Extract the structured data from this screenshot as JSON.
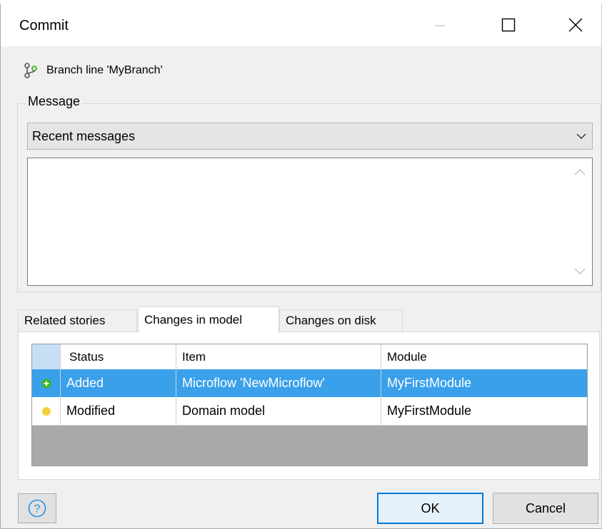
{
  "window": {
    "title": "Commit"
  },
  "branch": {
    "label": "Branch line 'MyBranch'"
  },
  "message": {
    "group_label": "Message",
    "recent_messages": "Recent messages",
    "text": ""
  },
  "tabs": [
    {
      "label": "Related stories"
    },
    {
      "label": "Changes in model",
      "active": true
    },
    {
      "label": "Changes on disk"
    }
  ],
  "changes_table": {
    "columns": [
      "Status",
      "Item",
      "Module"
    ],
    "rows": [
      {
        "status": "Added",
        "item": "Microflow 'NewMicroflow'",
        "module": "MyFirstModule",
        "status_color": "#3cb521",
        "selected": true
      },
      {
        "status": "Modified",
        "item": "Domain model",
        "module": "MyFirstModule",
        "status_color": "#f5d23c",
        "selected": false
      }
    ]
  },
  "buttons": {
    "help_icon": "question-circle-icon",
    "ok": "OK",
    "cancel": "Cancel"
  },
  "colors": {
    "selection": "#3aa0ea",
    "accent": "#0078d7"
  }
}
